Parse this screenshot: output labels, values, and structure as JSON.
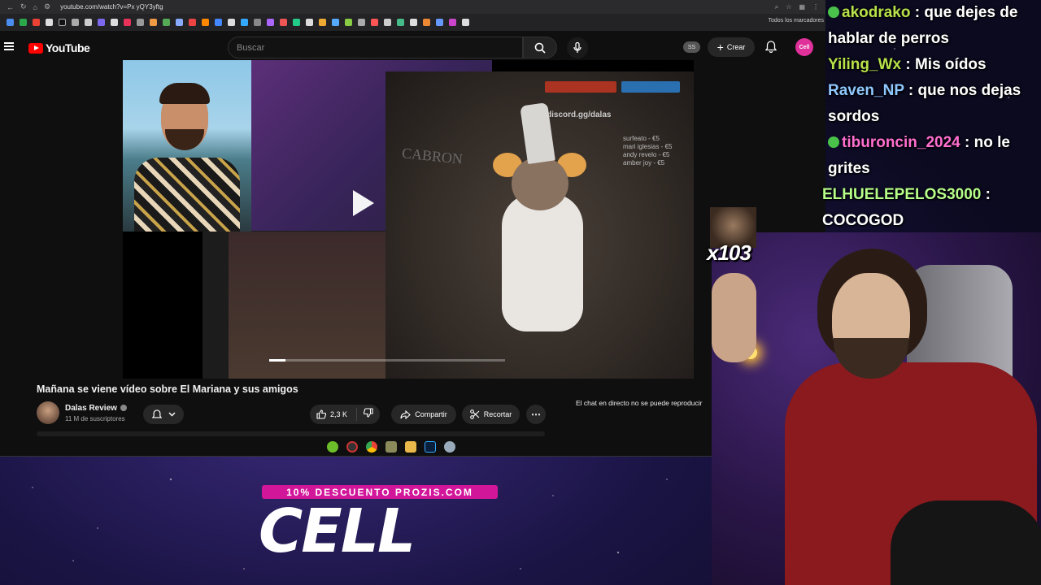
{
  "browser": {
    "url": "youtube.com/watch?v=Px yQY3yftg",
    "bookmarks_label": "Todos los marcadores"
  },
  "youtube": {
    "logo_text": "YouTube",
    "search_placeholder": "Buscar",
    "account_badge": "SS",
    "create_label": "Crear",
    "avatar_text": "Cell"
  },
  "video": {
    "title": "Mañana se viene vídeo sobre El Mariana y sus amigos",
    "overlay_text": "CABRON",
    "discord_text": "discord.gg/dalas",
    "donors": [
      "surfeato - €5",
      "mari iglesias - €5",
      "andy revelo - €5",
      "amber joy - €5"
    ],
    "progress": 0.07
  },
  "channel": {
    "name": "Dalas Review",
    "subscribers": "11 M de suscriptores"
  },
  "actions": {
    "likes": "2,3 K",
    "share_label": "Compartir",
    "clip_label": "Recortar"
  },
  "chat_note": "El chat en directo no se puede reproducir",
  "stream_chat": [
    {
      "user": "akodrako",
      "msg": " : que dejes de"
    },
    {
      "user": "",
      "msg": "hablar de perros"
    },
    {
      "user": "Yiling_Wx",
      "msg": " : Mis oídos"
    },
    {
      "user": "Raven_NP",
      "msg": " : que nos dejas"
    },
    {
      "user": "",
      "msg": "sordos"
    },
    {
      "user": "tiburoncin_2024",
      "msg": " : no le"
    },
    {
      "user": "",
      "msg": "grites"
    },
    {
      "user": "ELHUELEPELOS3000",
      "msg": " :"
    },
    {
      "user": "",
      "msg": "COCOGOD"
    }
  ],
  "emote_counter": "x103",
  "promo": {
    "bar": "10% DESCUENTO PROZIS.COM",
    "big": "CELL"
  }
}
